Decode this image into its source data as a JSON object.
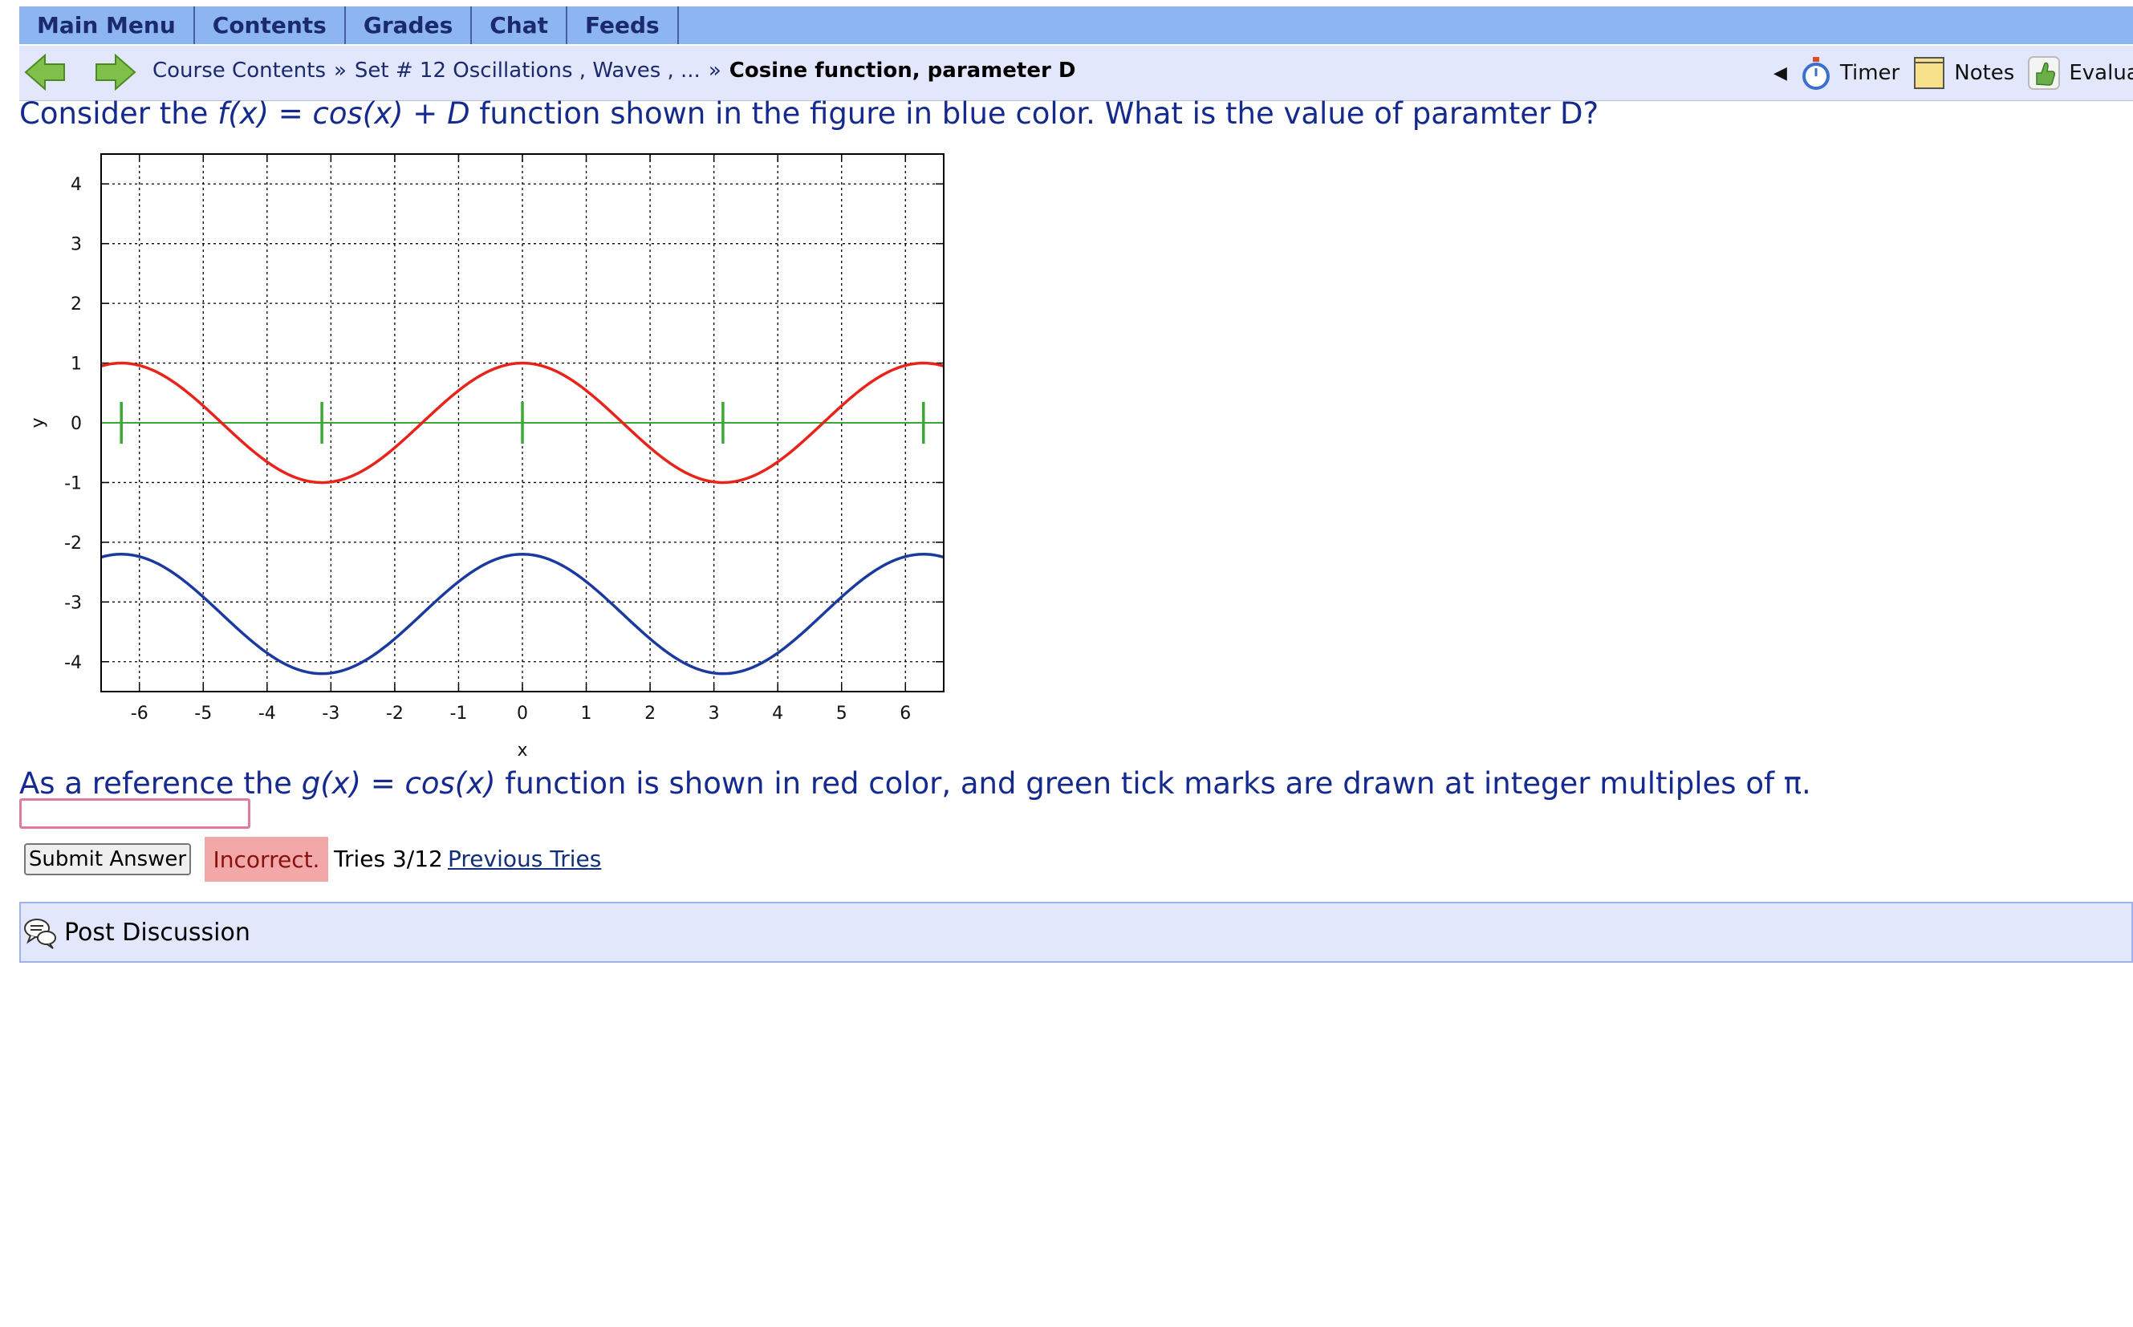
{
  "menu": {
    "items": [
      {
        "label": "Main Menu"
      },
      {
        "label": "Contents"
      },
      {
        "label": "Grades"
      },
      {
        "label": "Chat"
      },
      {
        "label": "Feeds"
      }
    ]
  },
  "nav": {
    "breadcrumb": {
      "item1": "Course Contents",
      "sep": "»",
      "item2": "Set # 12 Oscillations , Waves , ...",
      "current": "Cosine function, parameter D"
    },
    "tools": {
      "collapse_glyph": "◀",
      "timer": "Timer",
      "notes": "Notes",
      "evaluate": "Evaluat"
    },
    "icons": {
      "back": "back-arrow-icon",
      "forward": "forward-arrow-icon",
      "timer": "stopwatch-icon",
      "notes": "notepad-icon",
      "evaluate": "thumbs-up-icon"
    }
  },
  "question": {
    "p1_a": "Consider the ",
    "p1_f": "f(x)",
    "p1_eq": " = ",
    "p1_cos": "cos(x)",
    "p1_plus": " + ",
    "p1_D": "D",
    "p1_b": " function shown in the figure in blue color. What is the value of paramter D?",
    "p2_a": "As a reference the ",
    "p2_g": "g(x)",
    "p2_eq": " = ",
    "p2_cos": "cos(x)",
    "p2_b": " function is shown in red color, and green tick marks are drawn at integer multiples of π."
  },
  "answer": {
    "value": "",
    "submit_label": "Submit Answer",
    "status": "Incorrect.",
    "tries": "Tries 3/12",
    "previous_tries": "Previous Tries"
  },
  "discussion": {
    "label": "Post Discussion",
    "icon": "speech-bubbles-icon"
  },
  "colors": {
    "menu_bar": "#8cb5f2",
    "nav_bar": "#e3e7fb",
    "question_text": "#142a8f",
    "incorrect_bg": "#f2a8a8",
    "curve_f": "#1a3aa0",
    "curve_g": "#e8231a",
    "ticks": "#3aa832"
  },
  "chart_data": {
    "type": "line",
    "xlabel": "x",
    "ylabel": "y",
    "xlim": [
      -6.6,
      6.6
    ],
    "ylim": [
      -4.5,
      4.5
    ],
    "xticks": [
      -6,
      -5,
      -4,
      -3,
      -2,
      -1,
      0,
      1,
      2,
      3,
      4,
      5,
      6
    ],
    "yticks": [
      -4,
      -3,
      -2,
      -1,
      0,
      1,
      2,
      3,
      4
    ],
    "ytick_labels": [
      "-4",
      "-3",
      "-2",
      "-1",
      "0",
      "1",
      "2",
      "3",
      "4"
    ],
    "grid": true,
    "series": [
      {
        "color": "#e8231a",
        "function": "cos(x)",
        "offset": 0
      },
      {
        "color": "#1a3aa0",
        "function": "cos(x) + D",
        "offset": -3.2
      }
    ],
    "axis_line": {
      "y": 0,
      "color": "#3aa832"
    },
    "pi_ticks_x": [
      -6.2832,
      -3.1416,
      0,
      3.1416,
      6.2832
    ]
  }
}
